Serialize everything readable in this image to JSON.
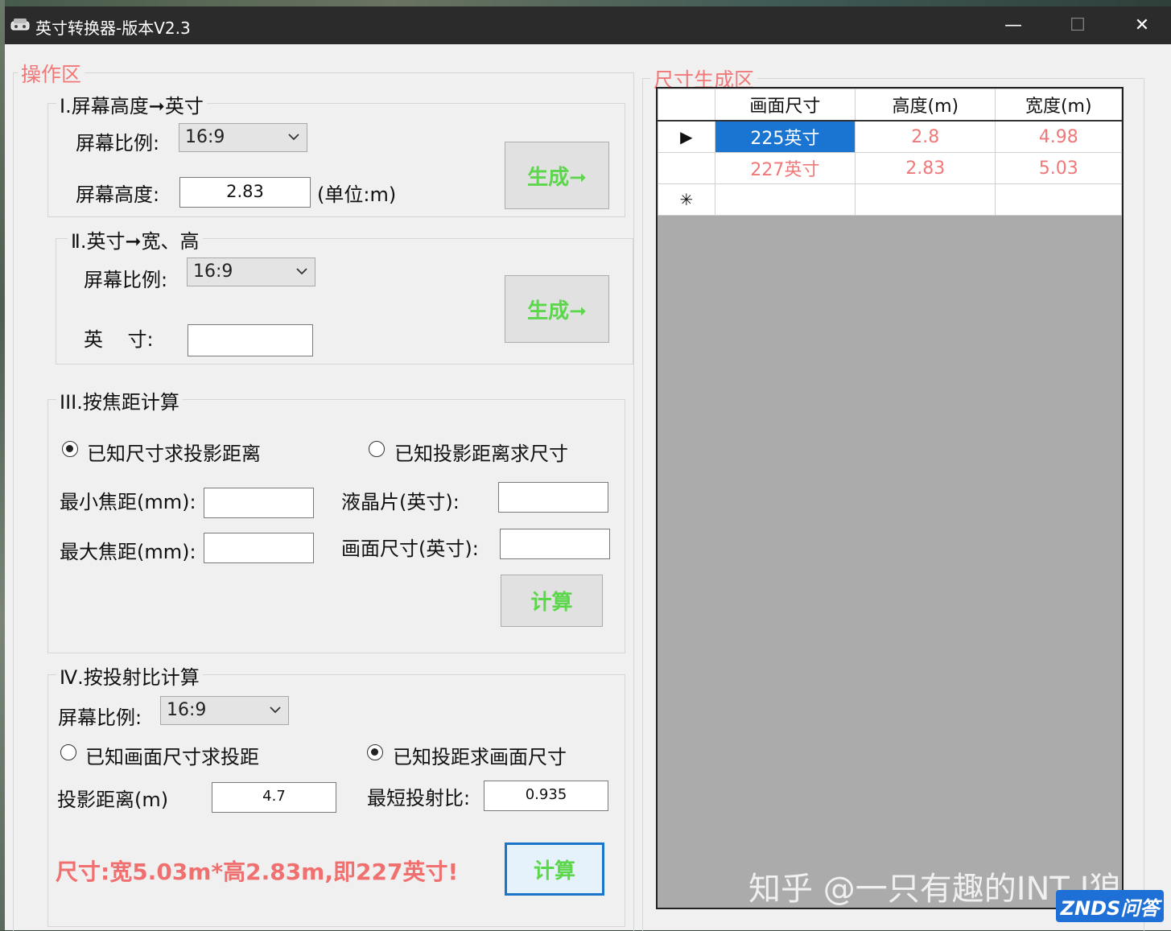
{
  "window": {
    "title": "英寸转换器-版本V2.3",
    "minimize": "—",
    "maximize": "☐",
    "close": "✕"
  },
  "operation_area": {
    "legend": "操作区",
    "section1": {
      "legend": "I.屏幕高度➞英寸",
      "ratio_label": "屏幕比例:",
      "ratio_value": "16:9",
      "height_label": "屏幕高度:",
      "height_value": "2.83",
      "unit": "(单位:m)",
      "button": "生成➞"
    },
    "section2": {
      "legend": "Ⅱ.英寸➞宽、高",
      "ratio_label": "屏幕比例:",
      "ratio_value": "16:9",
      "inch_label": "英    寸:",
      "inch_value": "",
      "button": "生成➞"
    },
    "section3": {
      "legend": "III.按焦距计算",
      "radio1": "已知尺寸求投影距离",
      "radio2": "已知投影距离求尺寸",
      "min_focal_label": "最小焦距(mm):",
      "max_focal_label": "最大焦距(mm):",
      "lcd_label": "液晶片(英寸):",
      "screen_size_label": "画面尺寸(英寸):",
      "min_focal_value": "",
      "max_focal_value": "",
      "lcd_value": "",
      "screen_size_value": "",
      "button": "计算"
    },
    "section4": {
      "legend": "Ⅳ.按投射比计算",
      "ratio_label": "屏幕比例:",
      "ratio_value": "16:9",
      "radio1": "已知画面尺寸求投距",
      "radio2": "已知投距求画面尺寸",
      "distance_label": "投影距离(m)",
      "distance_value": "4.7",
      "throw_ratio_label": "最短投射比:",
      "throw_ratio_value": "0.935",
      "button": "计算",
      "result": "尺寸:宽5.03m*高2.83m,即227英寸!"
    }
  },
  "size_area": {
    "legend": "尺寸生成区",
    "columns": [
      "画面尺寸",
      "高度(m)",
      "宽度(m)"
    ],
    "rows": [
      {
        "marker": "▶",
        "size": "225英寸",
        "height": "2.8",
        "width": "4.98"
      },
      {
        "marker": "",
        "size": "227英寸",
        "height": "2.83",
        "width": "5.03"
      },
      {
        "marker": "✳",
        "size": "",
        "height": "",
        "width": ""
      }
    ]
  },
  "overlay": {
    "watermark": "知乎 @一只有趣的INT J狼",
    "badge": "ZNDS问答"
  }
}
